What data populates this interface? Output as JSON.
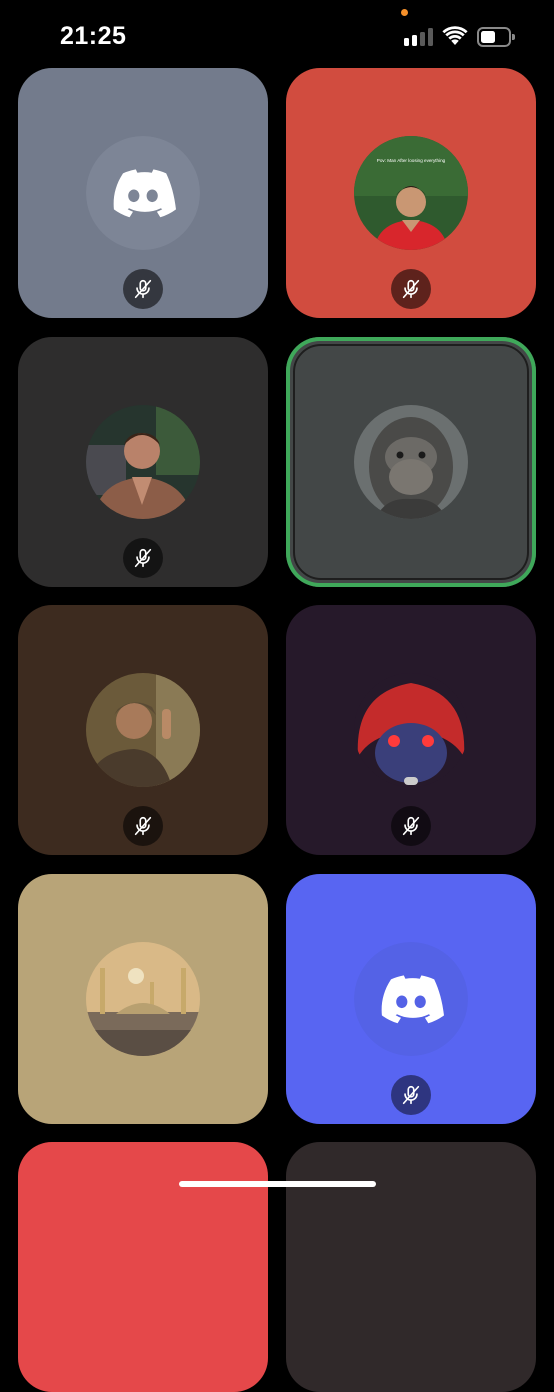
{
  "status_bar": {
    "time": "21:25",
    "cellular_bars_active": 2,
    "cellular_bars_total": 4,
    "wifi": "wifi-icon",
    "battery_level": 0.55
  },
  "colors": {
    "speaking_outline": "#3fa85a",
    "discord_blurple": "#5865f2"
  },
  "participants": [
    {
      "id": "p1",
      "tile_color": "#737b8c",
      "avatar": "discord-default-icon",
      "muted": true
    },
    {
      "id": "p2",
      "tile_color": "#d14c3f",
      "avatar": "user-avatar-photo",
      "avatar_caption": "Pov: Man After loosing everything",
      "muted": true
    },
    {
      "id": "p3",
      "tile_color": "#2e2d2d",
      "avatar": "user-avatar-photo",
      "muted": true
    },
    {
      "id": "p4",
      "tile_color": "#434747",
      "avatar": "user-avatar-photo",
      "muted": false,
      "speaking": true
    },
    {
      "id": "p5",
      "tile_color": "#3d2b1f",
      "avatar": "user-avatar-photo",
      "muted": true
    },
    {
      "id": "p6",
      "tile_color": "#26192a",
      "avatar": "user-avatar-photo",
      "muted": true
    },
    {
      "id": "p7",
      "tile_color": "#b8a478",
      "avatar": "user-avatar-photo",
      "muted": false
    },
    {
      "id": "p8",
      "tile_color": "#5865f2",
      "avatar": "discord-default-icon",
      "muted": true
    },
    {
      "id": "p9",
      "tile_color": "#e5484a",
      "avatar": "user-avatar-photo",
      "muted": false
    },
    {
      "id": "p10",
      "tile_color": "#30292a",
      "avatar": "user-avatar-photo",
      "muted": false
    }
  ]
}
